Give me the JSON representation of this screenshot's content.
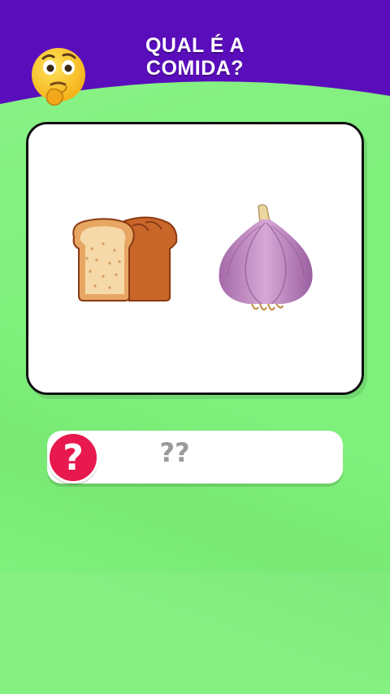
{
  "header": {
    "title_line1": "QUAL É A",
    "title_line2": "COMIDA?",
    "banner_color": "#5a0dbb",
    "emoji_icon": "thinking-face-icon"
  },
  "puzzle": {
    "emojis": [
      "bread-icon",
      "garlic-icon"
    ]
  },
  "answer": {
    "badge_glyph": "?",
    "text": "??",
    "badge_color": "#e8194e"
  },
  "colors": {
    "background": "#7ff07c",
    "card": "#ffffff",
    "card_border": "#111111"
  }
}
